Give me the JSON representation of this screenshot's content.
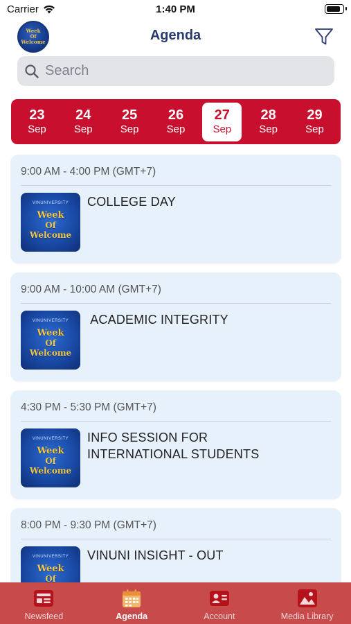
{
  "status_bar": {
    "carrier": "Carrier",
    "time": "1:40 PM",
    "battery_level": 0.9
  },
  "header": {
    "title": "Agenda",
    "logo_text": [
      "Week",
      "Of",
      "Welcome"
    ],
    "filter_icon": "filter-icon"
  },
  "search": {
    "placeholder": "Search",
    "value": "",
    "icon": "search-icon"
  },
  "dates": [
    {
      "day": "23",
      "month": "Sep",
      "selected": false
    },
    {
      "day": "24",
      "month": "Sep",
      "selected": false
    },
    {
      "day": "25",
      "month": "Sep",
      "selected": false
    },
    {
      "day": "26",
      "month": "Sep",
      "selected": false
    },
    {
      "day": "27",
      "month": "Sep",
      "selected": true
    },
    {
      "day": "28",
      "month": "Sep",
      "selected": false
    },
    {
      "day": "29",
      "month": "Sep",
      "selected": false
    }
  ],
  "thumbnail": {
    "brand": "VINUNIVERSITY",
    "line1": "Week",
    "line2": "Of",
    "line3": "Welcome"
  },
  "events": [
    {
      "time": "9:00 AM - 4:00 PM (GMT+7)",
      "title": "COLLEGE DAY"
    },
    {
      "time": "9:00 AM - 10:00 AM (GMT+7)",
      "title": " ACADEMIC INTEGRITY"
    },
    {
      "time": "4:30 PM - 5:30 PM (GMT+7)",
      "title": "INFO SESSION FOR INTERNATIONAL STUDENTS"
    },
    {
      "time": "8:00 PM - 9:30 PM (GMT+7)",
      "title": "VINUNI INSIGHT - OUT"
    }
  ],
  "tabbar": {
    "items": [
      {
        "label": "Newsfeed",
        "icon": "newsfeed-icon",
        "active": false
      },
      {
        "label": "Agenda",
        "icon": "calendar-icon",
        "active": true
      },
      {
        "label": "Account",
        "icon": "account-card-icon",
        "active": false
      },
      {
        "label": "Media Library",
        "icon": "image-gallery-icon",
        "active": false
      }
    ]
  },
  "colors": {
    "brand_red": "#c8102e",
    "tabbar_red": "#c74b4b",
    "title_navy": "#283a6e",
    "card_bg": "#e7f1fc",
    "active_tab_icon": "#f5b56a"
  }
}
